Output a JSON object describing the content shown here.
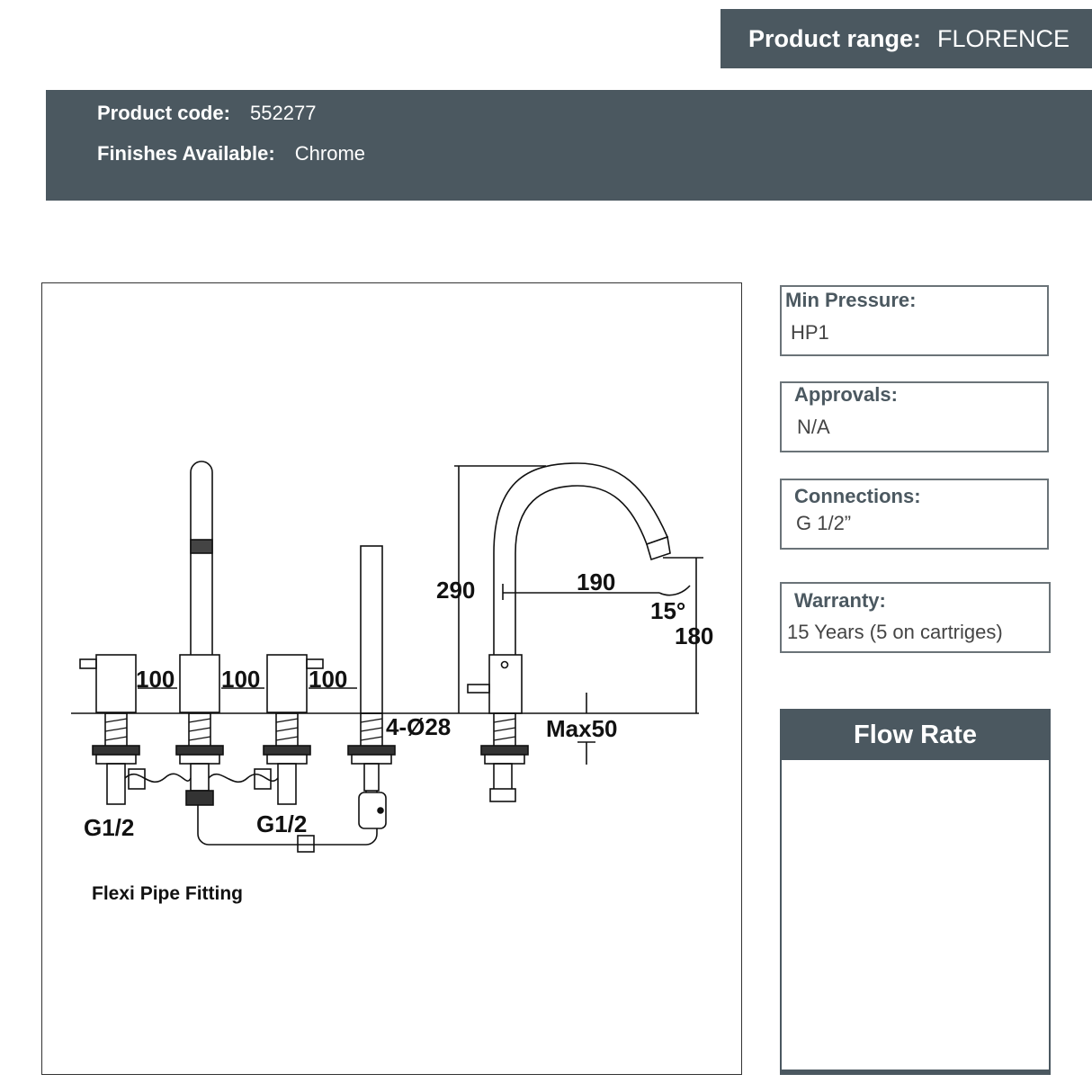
{
  "header": {
    "product_range_label": "Product range:",
    "product_range_value": "FLORENCE"
  },
  "info": {
    "product_code_label": "Product code:",
    "product_code_value": "552277",
    "finishes_label": "Finishes Available:",
    "finishes_value": "Chrome"
  },
  "drawing": {
    "dims": {
      "spacing_1": "100",
      "spacing_2": "100",
      "spacing_3": "100",
      "height_total": "290",
      "reach": "190",
      "angle": "15°",
      "height_spout": "180",
      "holes": "4-Ø28",
      "deck_max": "Max50",
      "connection_left": "G1/2",
      "connection_mid": "G1/2"
    },
    "caption": "Flexi Pipe Fitting"
  },
  "specs": {
    "min_pressure_label": "Min Pressure:",
    "min_pressure_value": "HP1",
    "approvals_label": "Approvals:",
    "approvals_value": "N/A",
    "connections_label": "Connections:",
    "connections_value": "G 1/2”",
    "warranty_label": "Warranty:",
    "warranty_value": "15 Years (5 on cartriges)"
  },
  "flow_rate": {
    "title": "Flow Rate"
  }
}
